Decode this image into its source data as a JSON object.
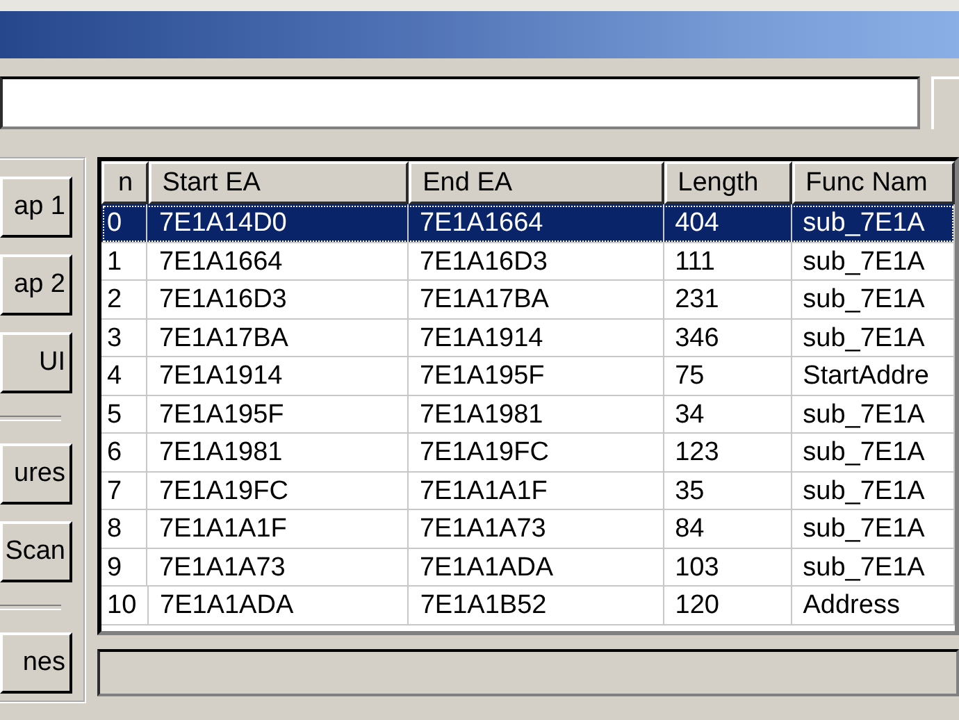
{
  "side_buttons": [
    {
      "label": "ap 1",
      "kind": "button"
    },
    {
      "label": "ap 2",
      "kind": "button"
    },
    {
      "label": "UI",
      "kind": "button"
    },
    {
      "kind": "separator"
    },
    {
      "label": "ures",
      "kind": "button"
    },
    {
      "label": "Scan",
      "kind": "button"
    },
    {
      "kind": "separator"
    },
    {
      "label": "nes",
      "kind": "button"
    }
  ],
  "table": {
    "columns": [
      "n",
      "Start EA",
      "End EA",
      "Length",
      "Func Nam"
    ],
    "rows": [
      {
        "cells": [
          "0",
          "7E1A14D0",
          "7E1A1664",
          "404",
          "sub_7E1A"
        ],
        "selected": true
      },
      {
        "cells": [
          "1",
          "7E1A1664",
          "7E1A16D3",
          "111",
          "sub_7E1A"
        ],
        "selected": false
      },
      {
        "cells": [
          "2",
          "7E1A16D3",
          "7E1A17BA",
          "231",
          "sub_7E1A"
        ],
        "selected": false
      },
      {
        "cells": [
          "3",
          "7E1A17BA",
          "7E1A1914",
          "346",
          "sub_7E1A"
        ],
        "selected": false
      },
      {
        "cells": [
          "4",
          "7E1A1914",
          "7E1A195F",
          "75",
          "StartAddre"
        ],
        "selected": false
      },
      {
        "cells": [
          "5",
          "7E1A195F",
          "7E1A1981",
          "34",
          "sub_7E1A"
        ],
        "selected": false
      },
      {
        "cells": [
          "6",
          "7E1A1981",
          "7E1A19FC",
          "123",
          "sub_7E1A"
        ],
        "selected": false
      },
      {
        "cells": [
          "7",
          "7E1A19FC",
          "7E1A1A1F",
          "35",
          "sub_7E1A"
        ],
        "selected": false
      },
      {
        "cells": [
          "8",
          "7E1A1A1F",
          "7E1A1A73",
          "84",
          "sub_7E1A"
        ],
        "selected": false
      },
      {
        "cells": [
          "9",
          "7E1A1A73",
          "7E1A1ADA",
          "103",
          "sub_7E1A"
        ],
        "selected": false
      },
      {
        "cells": [
          "10",
          "7E1A1ADA",
          "7E1A1B52",
          "120",
          "Address"
        ],
        "selected": false
      }
    ]
  }
}
